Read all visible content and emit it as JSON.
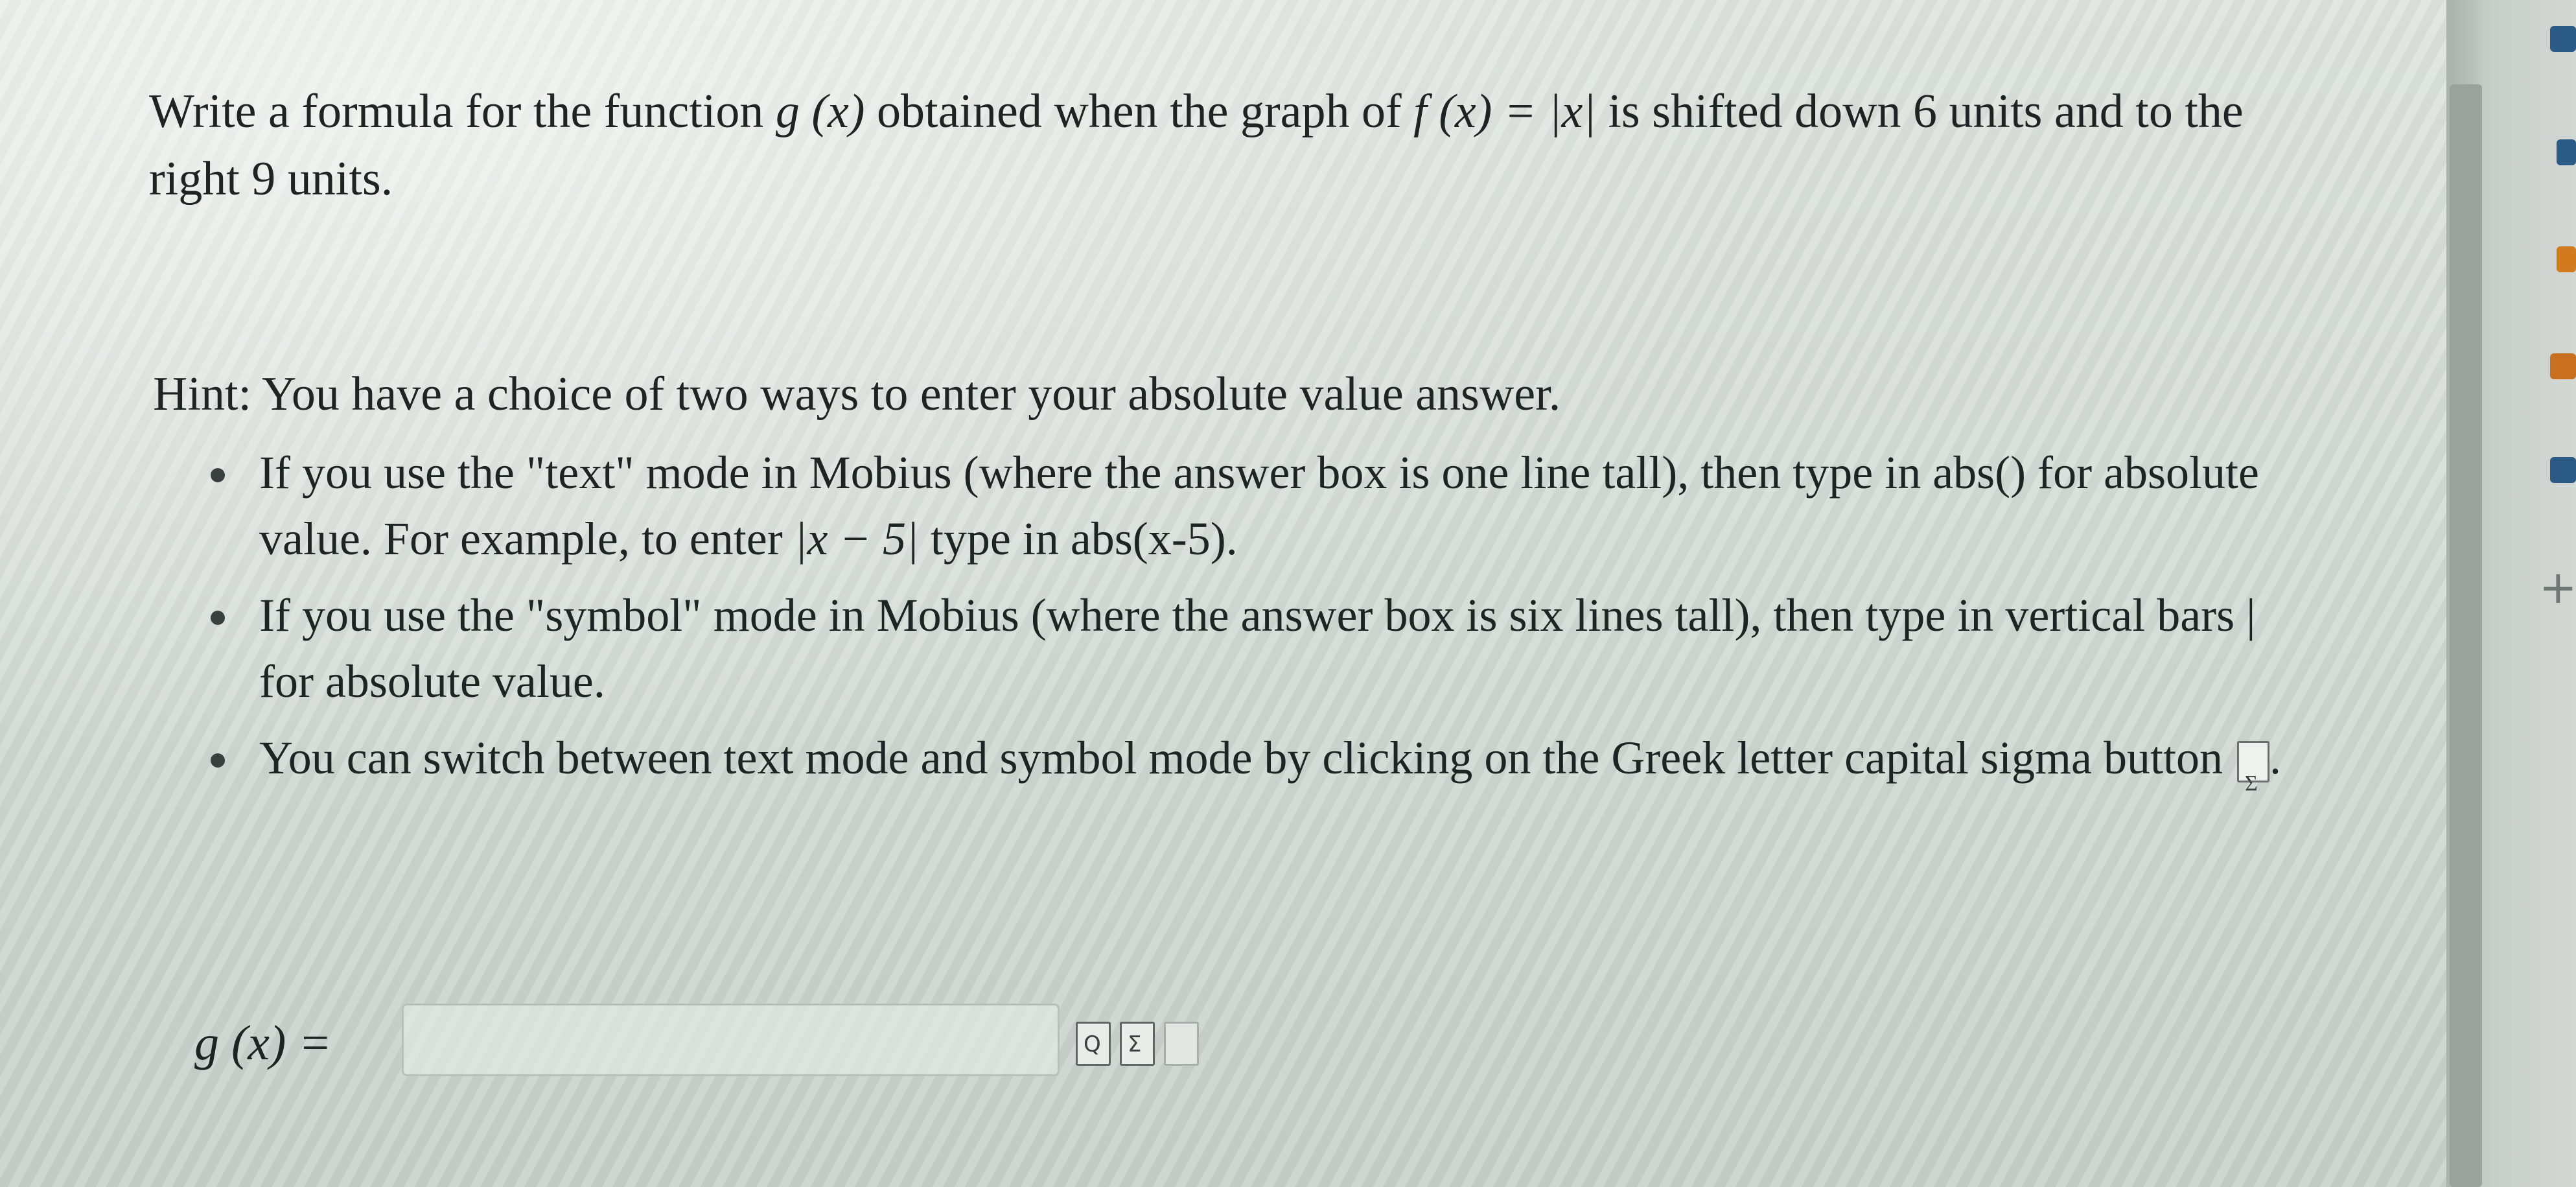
{
  "question": {
    "p1": "Write a formula for the function ",
    "m1": "g (x)",
    "p2": " obtained when the graph of ",
    "m2": "f (x) = |x|",
    "p3": " is shifted down 6 units and to the right 9 units."
  },
  "hint": {
    "intro": "Hint: You have a choice of two ways to enter your absolute value answer.",
    "b1_p1": "If you use the \"text\" mode in Mobius (where the answer box is one line tall), then type in abs() for absolute value. For example, to enter ",
    "b1_m1": "|x − 5|",
    "b1_p2": " type in abs(x-5).",
    "b2": "If you use the \"symbol\" mode in Mobius (where the answer box is six lines tall), then type in vertical bars | for absolute value.",
    "b3_p1": "You can switch between text mode and symbol mode by clicking on the Greek letter capital sigma button",
    "b3_p2": ".",
    "sigma_glyph": "Σ"
  },
  "answer": {
    "label": "g (x) =",
    "value": "",
    "placeholder": ""
  },
  "toolbar": {
    "preview_glyph": "Q",
    "sigma_glyph": "Σ",
    "icons": [
      "preview-icon",
      "sigma-icon",
      "document-icon"
    ]
  },
  "side": {
    "plus": "+",
    "accent_colors": [
      "#2b5a86",
      "#d27a1e",
      "#2b5a86",
      "#6f7674"
    ]
  }
}
